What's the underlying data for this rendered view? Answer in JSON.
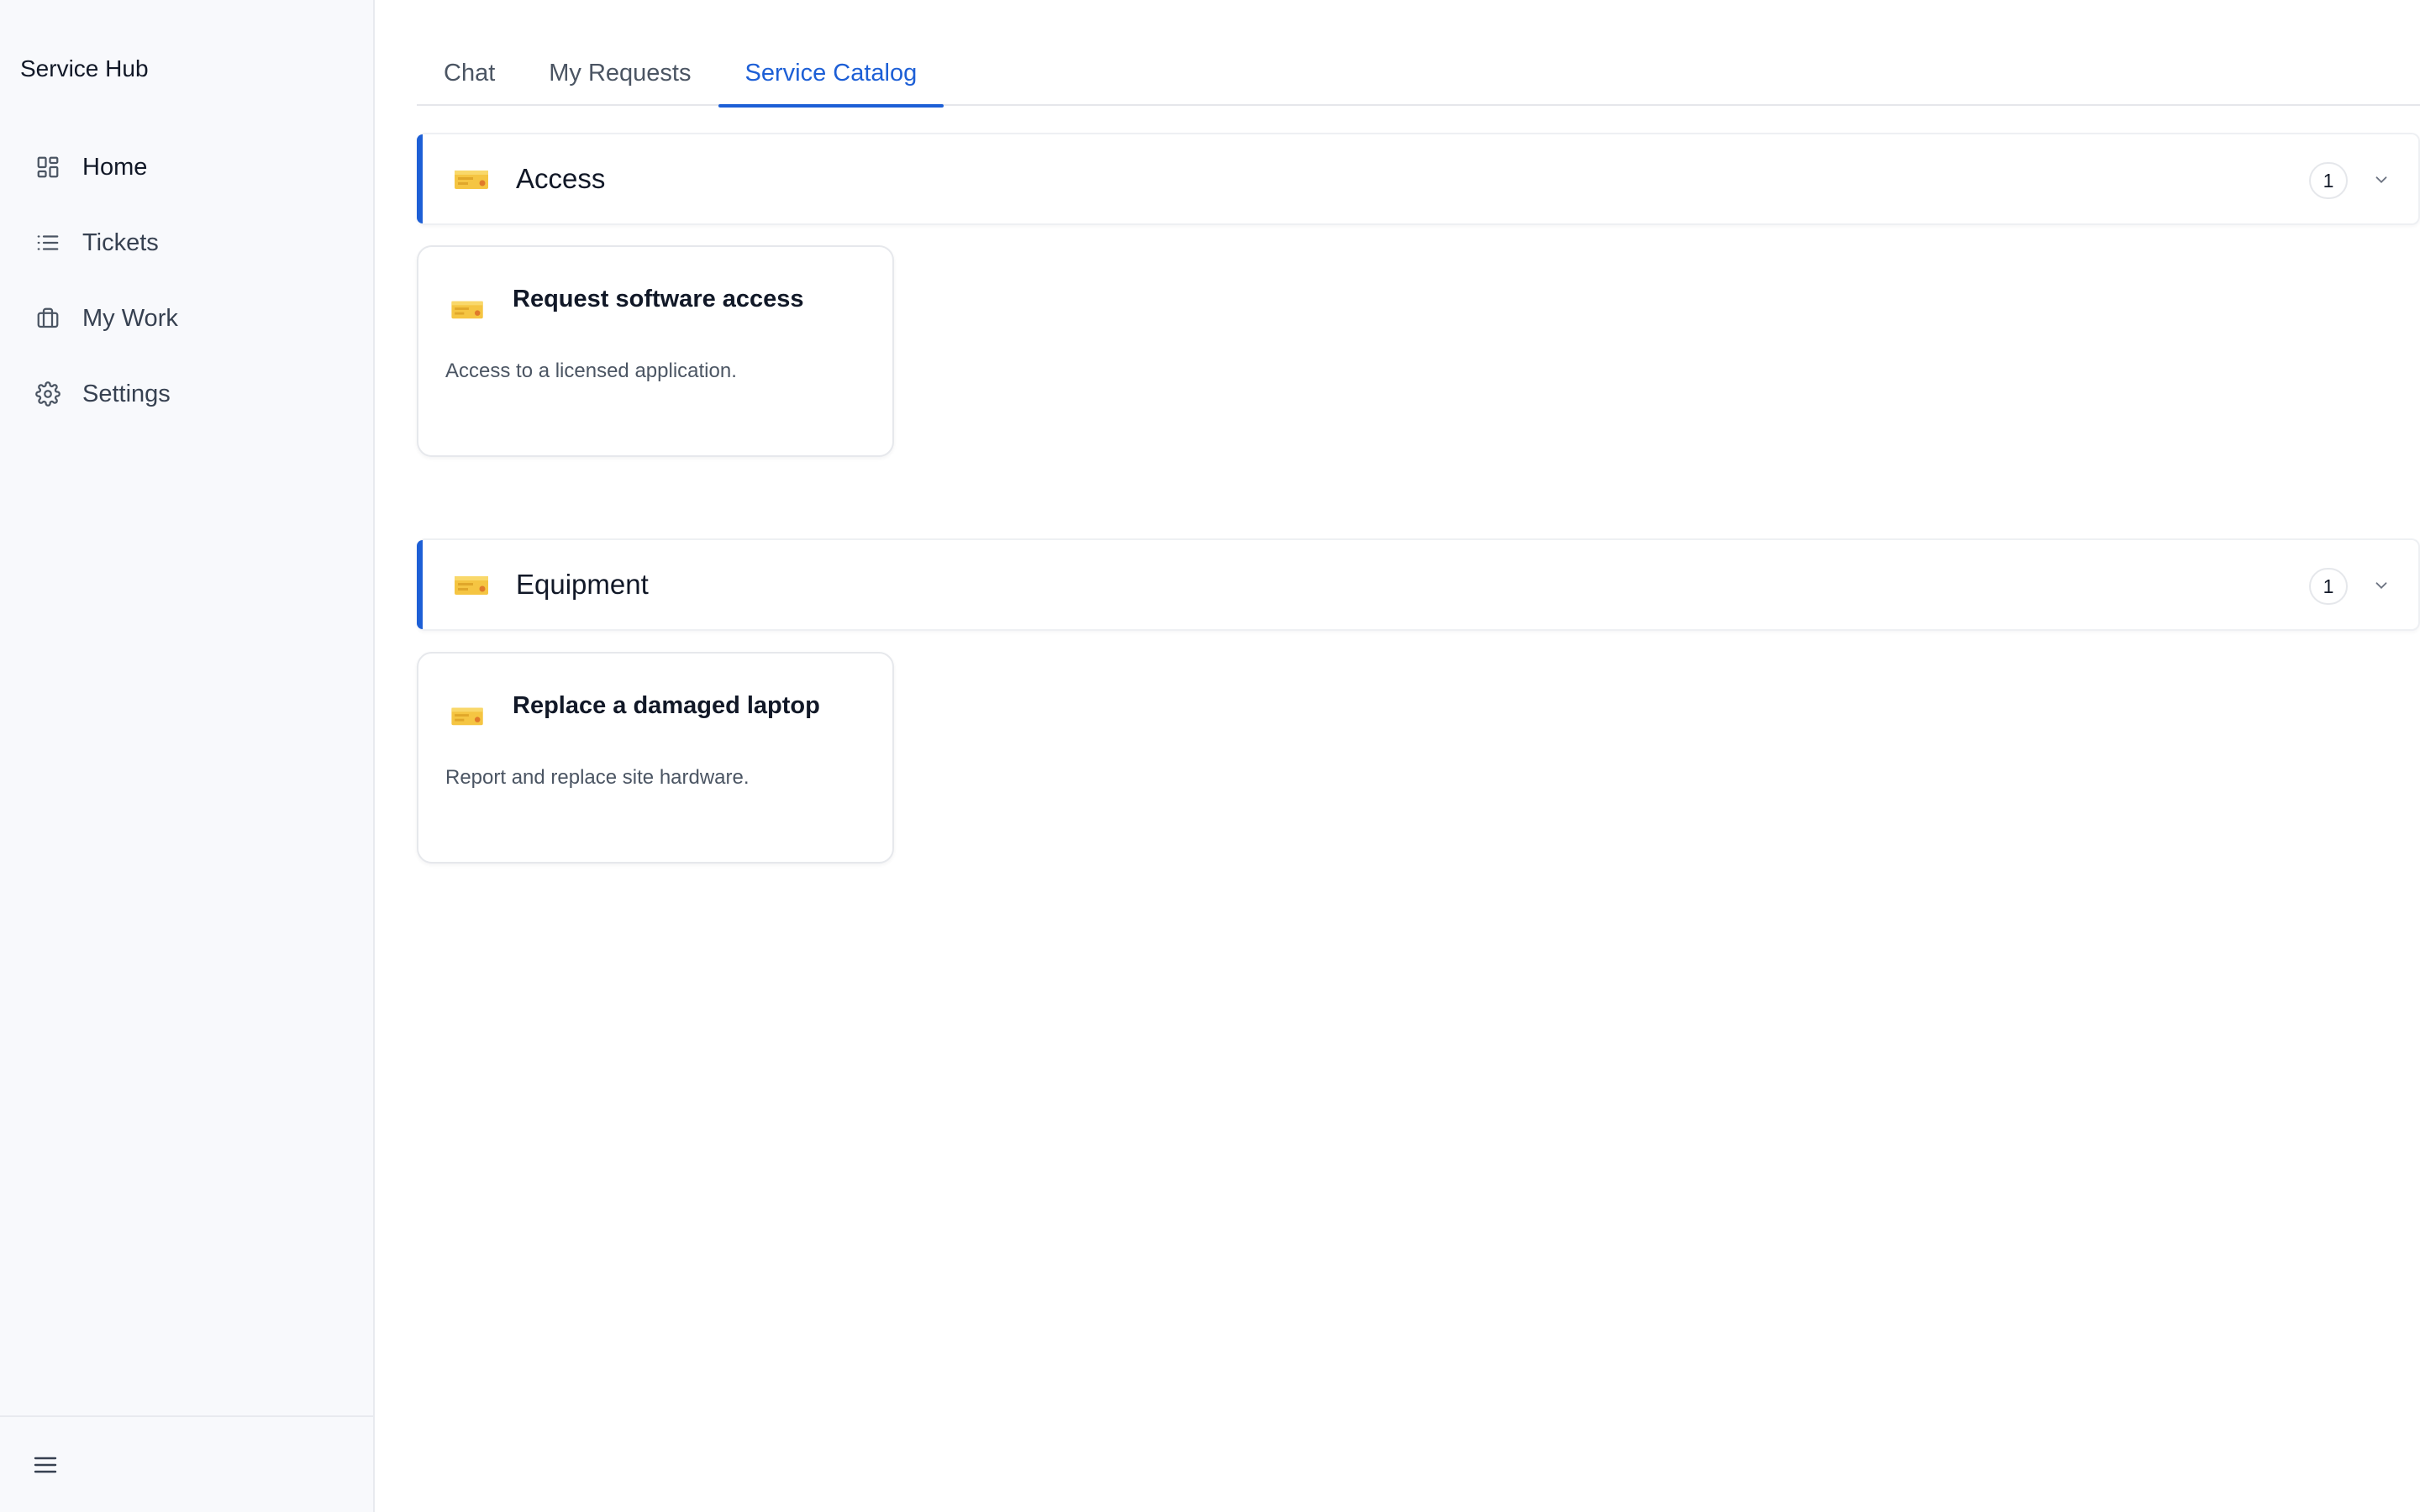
{
  "app": {
    "title": "Service Hub"
  },
  "sidebar": {
    "items": [
      {
        "label": "Home",
        "icon": "grid-icon",
        "active": true
      },
      {
        "label": "Tickets",
        "icon": "list-icon",
        "active": false
      },
      {
        "label": "My Work",
        "icon": "briefcase-icon",
        "active": false
      },
      {
        "label": "Settings",
        "icon": "gear-icon",
        "active": false
      }
    ],
    "footer_icon": "hamburger-menu-icon"
  },
  "tabs": [
    {
      "label": "Chat",
      "active": false
    },
    {
      "label": "My Requests",
      "active": false
    },
    {
      "label": "Service Catalog",
      "active": true
    }
  ],
  "catalog": {
    "sections": [
      {
        "title": "Access",
        "count": "1",
        "icon": "ticket-icon",
        "cards": [
          {
            "title": "Request software access",
            "description": "Access to a licensed application.",
            "icon": "ticket-icon"
          }
        ]
      },
      {
        "title": "Equipment",
        "count": "1",
        "icon": "ticket-icon",
        "cards": [
          {
            "title": "Replace a damaged laptop",
            "description": "Report and replace site hardware.",
            "icon": "ticket-icon"
          }
        ]
      }
    ]
  },
  "colors": {
    "accent": "#1d5fd6",
    "sidebar_bg": "#f8f9fc",
    "ticket_yellow": "#f5c542"
  }
}
